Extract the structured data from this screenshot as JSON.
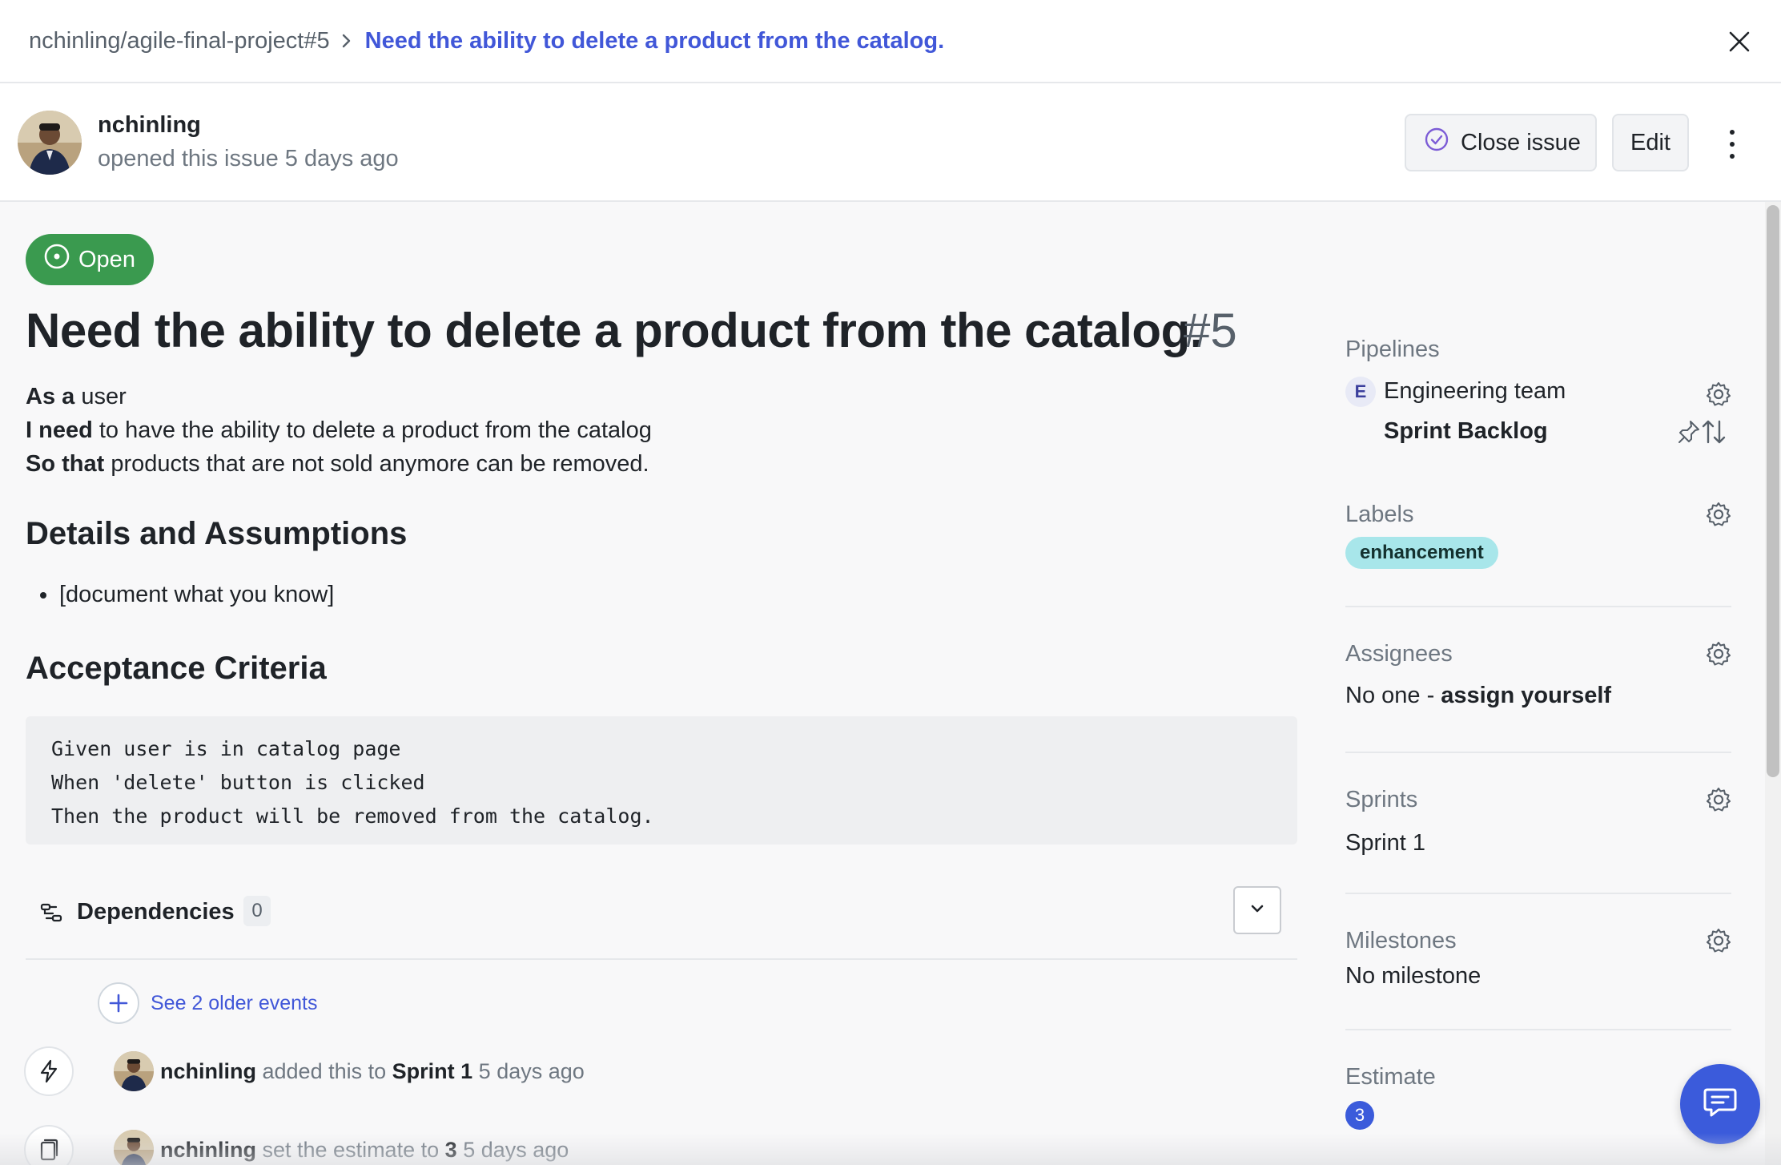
{
  "breadcrumb": {
    "repo": "nchinling/agile-final-project#5",
    "title": "Need the ability to delete a product from the catalog."
  },
  "header": {
    "author": "nchinling",
    "opened_text": "opened this issue 5 days ago",
    "close_issue_label": "Close issue",
    "edit_label": "Edit"
  },
  "issue": {
    "status": "Open",
    "title": "Need the ability to delete a product from the catalog.",
    "number": "#5",
    "story": [
      {
        "bold": "As a",
        "rest": " user"
      },
      {
        "bold": "I need",
        "rest": " to have the ability to delete a product from the catalog"
      },
      {
        "bold": "So that",
        "rest": " products that are not sold anymore can be removed."
      }
    ],
    "details_heading": "Details and Assumptions",
    "details_items": [
      "[document what you know]"
    ],
    "acceptance_heading": "Acceptance Criteria",
    "acceptance_code": [
      "Given user is in catalog page",
      "When 'delete' button is clicked",
      "Then the product will be removed from the catalog."
    ],
    "dependencies_label": "Dependencies",
    "dependencies_count": "0",
    "older_events_label": "See 2 older events",
    "events": [
      {
        "user": "nchinling",
        "action": "added this to",
        "target": "Sprint 1",
        "time": "5 days ago"
      },
      {
        "user": "nchinling",
        "action": "set the estimate to",
        "target": "3",
        "time": "5 days ago"
      }
    ]
  },
  "sidebar": {
    "pipelines_title": "Pipelines",
    "pipeline_badge": "E",
    "pipeline_team": "Engineering team",
    "pipeline_stage": "Sprint Backlog",
    "labels_title": "Labels",
    "label": "enhancement",
    "assignees_title": "Assignees",
    "assignees_none": "No one - ",
    "assign_yourself": "assign yourself",
    "sprints_title": "Sprints",
    "sprint_value": "Sprint 1",
    "milestones_title": "Milestones",
    "milestone_value": "No milestone",
    "estimate_title": "Estimate",
    "estimate_value": "3"
  },
  "colors": {
    "accent": "#4157d8",
    "open_green": "#3a9a4f",
    "label_teal": "#a8e6ea",
    "estimate_blue": "#3b5bdb"
  },
  "icons": [
    "close-icon",
    "chevron-right-icon",
    "check-circle-icon",
    "kebab-icon",
    "open-issue-icon",
    "dependencies-icon",
    "chevron-down-icon",
    "plus-icon",
    "lightning-icon",
    "clipboard-icon",
    "gear-icon",
    "pin-icon",
    "sort-arrows-icon",
    "chat-icon"
  ]
}
